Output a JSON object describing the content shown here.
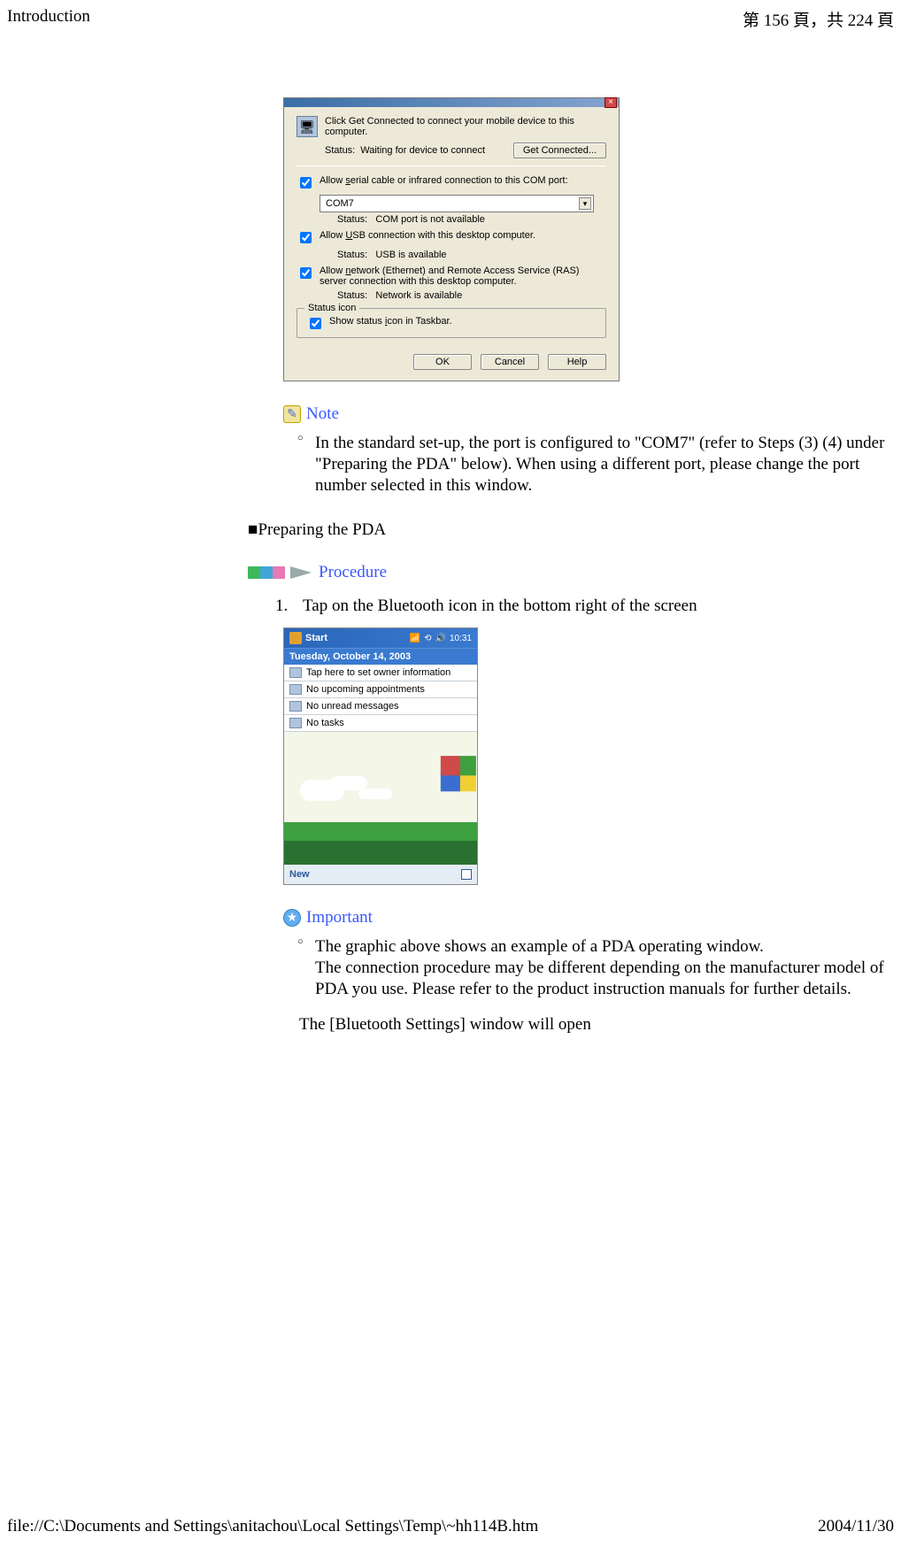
{
  "header": {
    "left": "Introduction",
    "right": "第 156 頁，共 224 頁"
  },
  "footer": {
    "left": "file://C:\\Documents and Settings\\anitachou\\Local Settings\\Temp\\~hh114B.htm",
    "right": "2004/11/30"
  },
  "dialog": {
    "message": "Click Get Connected to connect your mobile device to this computer.",
    "status_label": "Status:",
    "status_value": "Waiting for device to connect",
    "get_connected": "Get Connected...",
    "cb_serial": "Allow serial cable or infrared connection to this COM port:",
    "combo_value": "COM7",
    "serial_status": "COM port is not available",
    "cb_usb": "Allow USB connection with this desktop computer.",
    "usb_status": "USB is available",
    "cb_net": "Allow network (Ethernet) and Remote Access Service (RAS) server connection with this desktop computer.",
    "net_status": "Network is available",
    "group_legend": "Status icon",
    "cb_tray": "Show status icon in Taskbar.",
    "ok": "OK",
    "cancel": "Cancel",
    "help": "Help",
    "status_word": "Status:"
  },
  "note": {
    "label": "Note",
    "text": "In the standard set-up, the port is configured to \"COM7\" (refer to Steps (3) (4) under \"Preparing the PDA\" below). When using a different port, please change the port number selected in this window."
  },
  "section_heading": "Preparing the PDA",
  "procedure_label": "Procedure",
  "step1": "Tap on the Bluetooth icon in the bottom right of the screen",
  "pda": {
    "start": "Start",
    "time": "10:31",
    "date": "Tuesday, October 14, 2003",
    "row_owner": "Tap here to set owner information",
    "row_appt": "No upcoming appointments",
    "row_msg": "No unread messages",
    "row_task": "No tasks",
    "new": "New"
  },
  "important": {
    "label": "Important",
    "line1": "The graphic above shows an example of a PDA operating window.",
    "line2": "The connection procedure may be different depending on the manufacturer model of PDA you use. Please refer to the product instruction manuals for further details."
  },
  "trail": "The [Bluetooth Settings] window will open"
}
